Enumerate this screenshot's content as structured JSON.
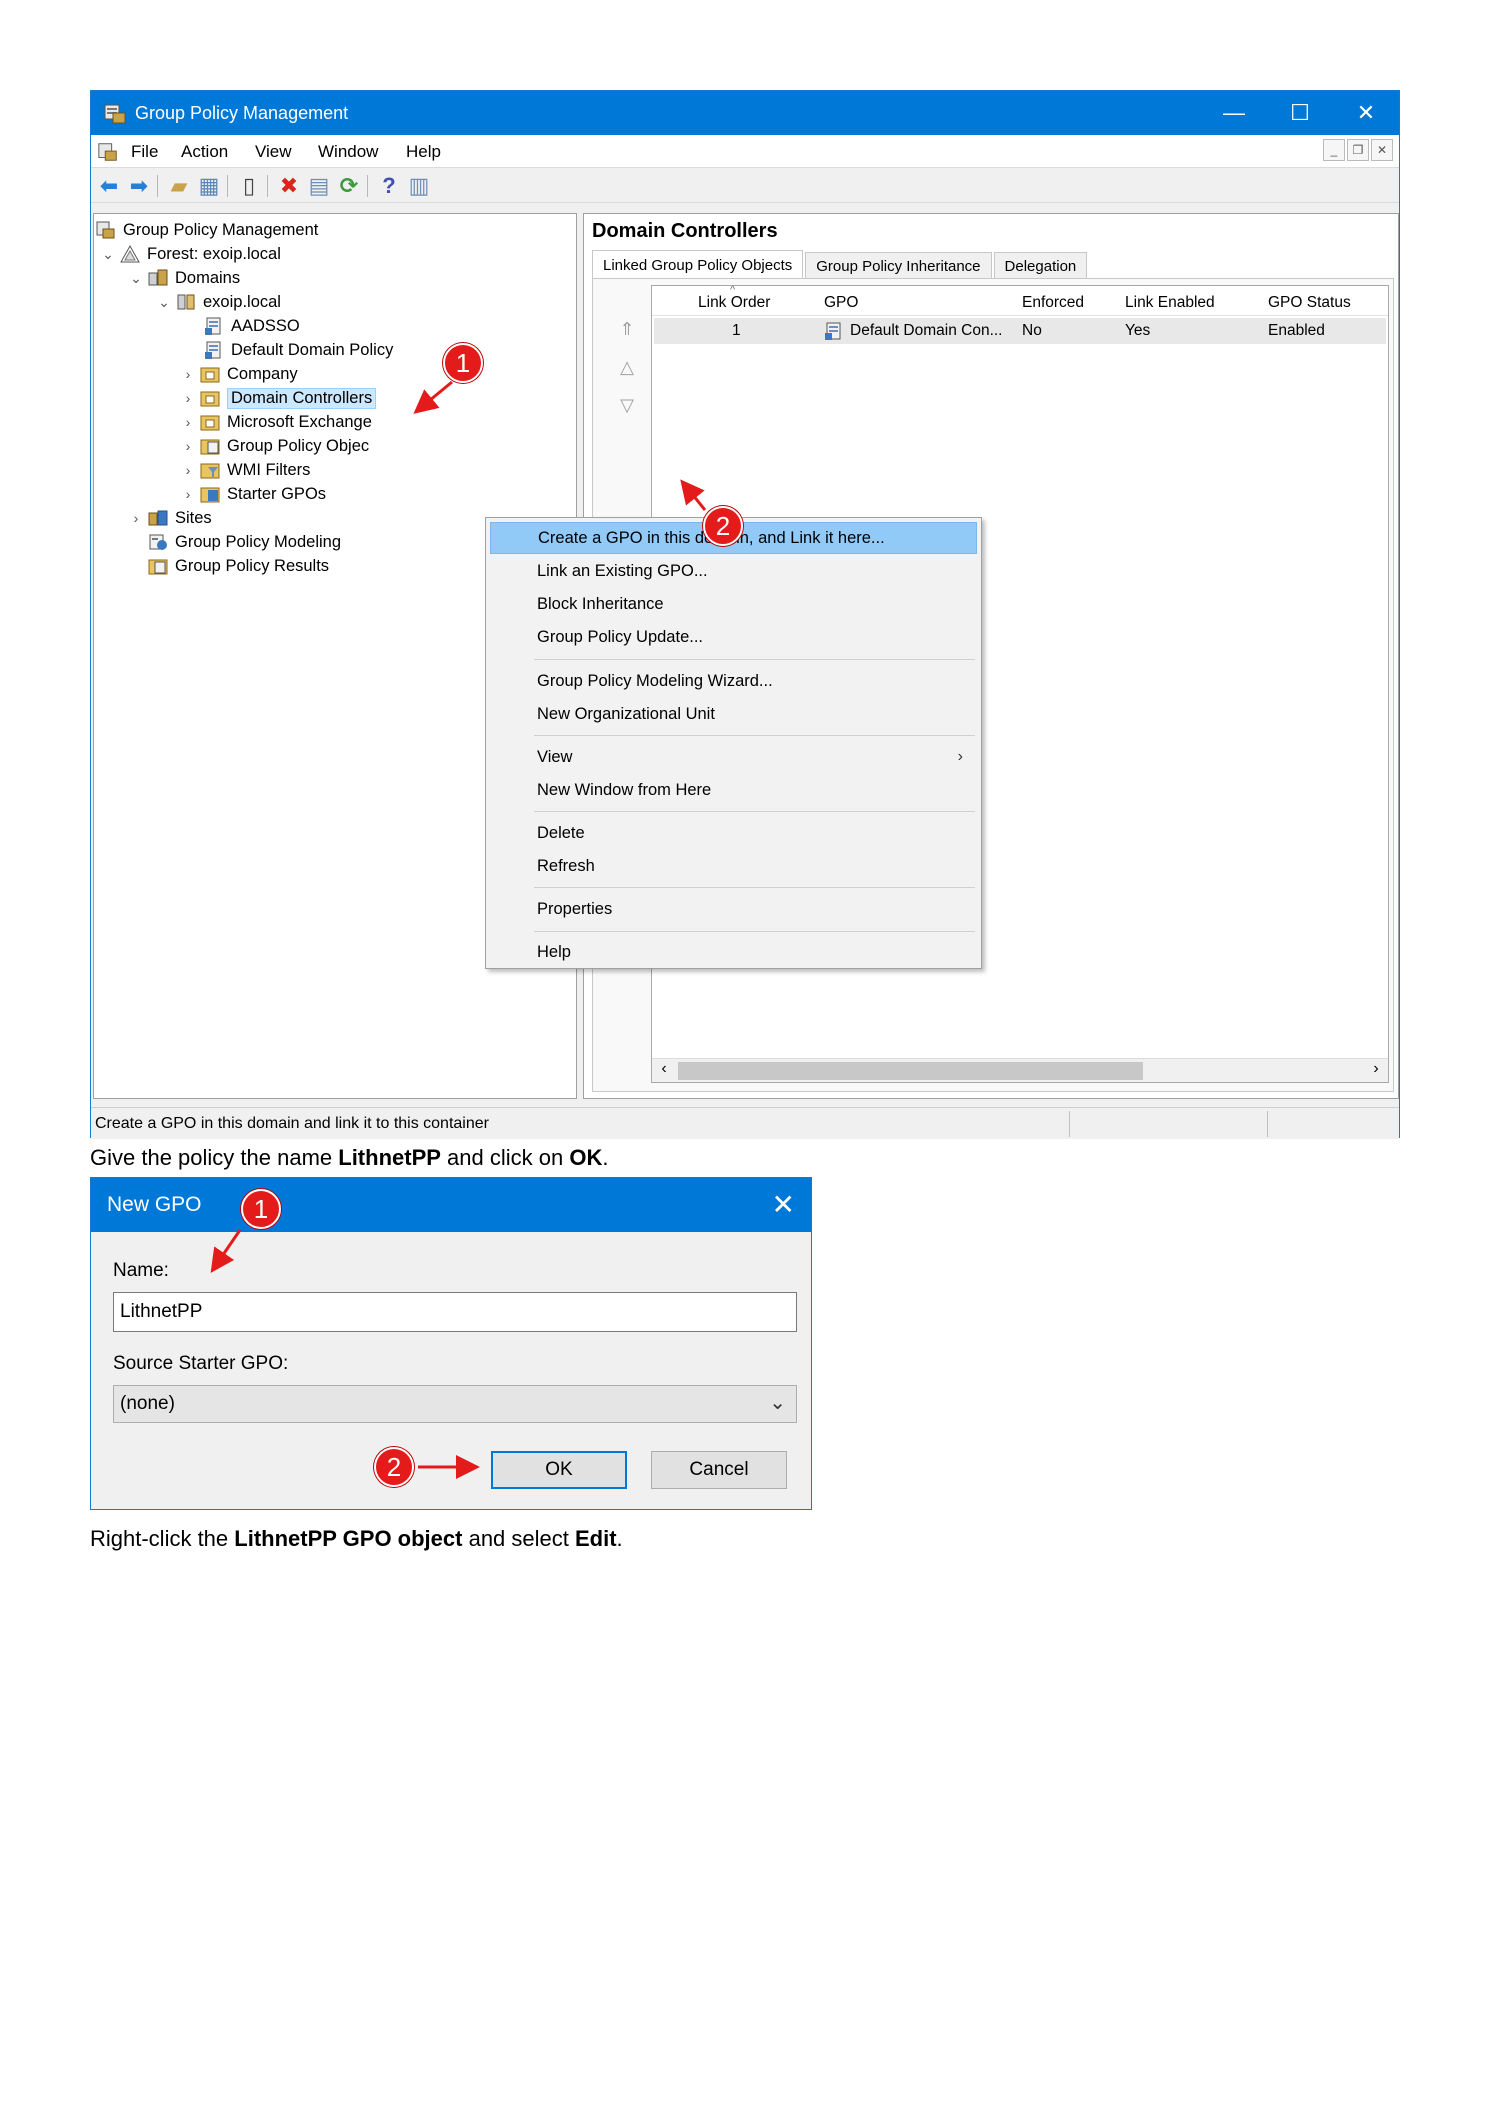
{
  "window": {
    "title": "Group Policy Management",
    "menu": [
      "File",
      "Action",
      "View",
      "Window",
      "Help"
    ]
  },
  "tree": {
    "items": [
      {
        "label": "Group Policy Management",
        "expander": ""
      },
      {
        "label": "Forest: exoip.local",
        "expander": "⌄"
      },
      {
        "label": "Domains",
        "expander": "⌄"
      },
      {
        "label": "exoip.local",
        "expander": "⌄"
      },
      {
        "label": "AADSSO",
        "expander": ""
      },
      {
        "label": "Default Domain Policy",
        "expander": ""
      },
      {
        "label": "Company",
        "expander": "›"
      },
      {
        "label": "Domain Controllers",
        "expander": "›"
      },
      {
        "label": "Microsoft Exchange",
        "expander": "›"
      },
      {
        "label": "Group Policy Objec",
        "expander": "›"
      },
      {
        "label": "WMI Filters",
        "expander": "›"
      },
      {
        "label": "Starter GPOs",
        "expander": "›"
      },
      {
        "label": "Sites",
        "expander": "›"
      },
      {
        "label": "Group Policy Modeling",
        "expander": ""
      },
      {
        "label": "Group Policy Results",
        "expander": ""
      }
    ]
  },
  "right": {
    "title": "Domain Controllers",
    "tabs": [
      "Linked Group Policy Objects",
      "Group Policy Inheritance",
      "Delegation"
    ],
    "columns": [
      "Link Order",
      "GPO",
      "Enforced",
      "Link Enabled",
      "GPO Status"
    ],
    "row": {
      "order": "1",
      "gpo": "Default Domain Con...",
      "enforced": "No",
      "link_enabled": "Yes",
      "status": "Enabled"
    }
  },
  "context_menu": {
    "items": [
      "Create a GPO in this domain, and Link it here...",
      "Link an Existing GPO...",
      "Block Inheritance",
      "Group Policy Update...",
      "Group Policy Modeling Wizard...",
      "New Organizational Unit",
      "View",
      "New Window from Here",
      "Delete",
      "Refresh",
      "Properties",
      "Help"
    ],
    "submenu_glyph": "›"
  },
  "status": "Create a GPO in this domain and link it to this container",
  "badges": {
    "one": "1",
    "two": "2"
  },
  "caption1": {
    "pre": "Give the policy the name ",
    "b1": "LithnetPP",
    "mid": " and click on ",
    "b2": "OK",
    "post": "."
  },
  "dialog": {
    "title": "New GPO",
    "name_label": "Name:",
    "name_value": "LithnetPP",
    "starter_label": "Source Starter GPO:",
    "starter_value": "(none)",
    "ok": "OK",
    "cancel": "Cancel"
  },
  "caption2": {
    "pre": "Right-click the ",
    "b1": "LithnetPP GPO object",
    "mid": " and select ",
    "b2": "Edit",
    "post": "."
  },
  "colors": {
    "titlebar": "#0078d7",
    "highlight": "#91c9f7",
    "badge": "#e41b1b"
  }
}
